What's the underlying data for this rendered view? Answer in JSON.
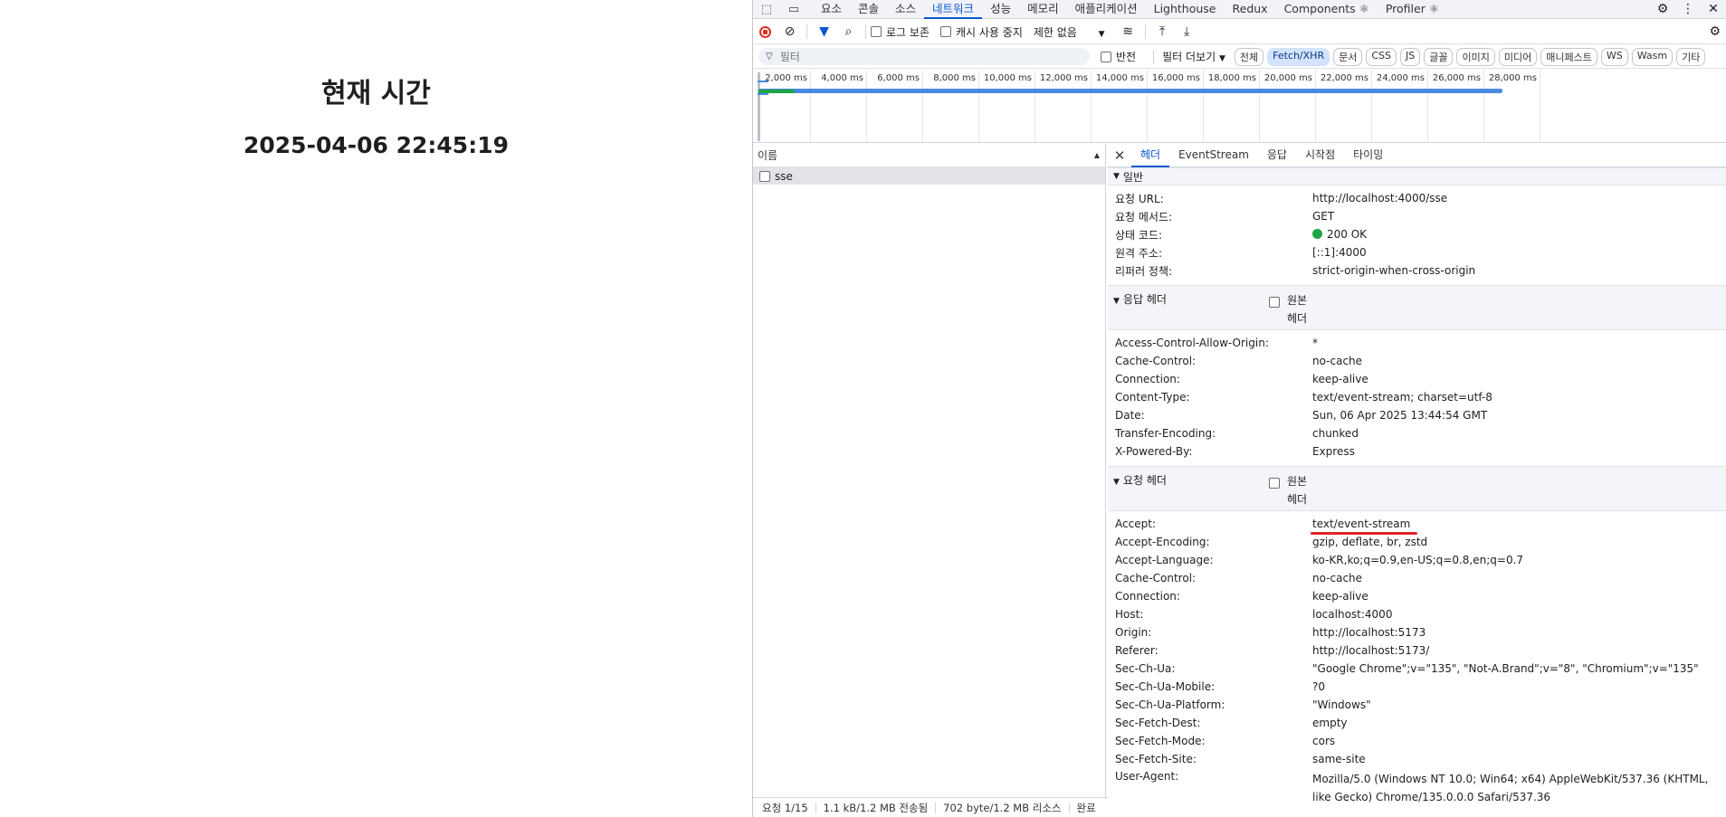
{
  "page": {
    "heading": "현재 시간",
    "current_time": "2025-04-06 22:45:19"
  },
  "devtools": {
    "tabs": [
      "요소",
      "콘솔",
      "소스",
      "네트워크",
      "성능",
      "메모리",
      "애플리케이션",
      "Lighthouse",
      "Redux",
      "Components ⚛",
      "Profiler ⚛"
    ],
    "active_tab": "네트워크",
    "toolbar": {
      "preserve_log": "로그 보존",
      "disable_cache": "캐시 사용 중지",
      "throttle": "제한 없음"
    },
    "filter": {
      "placeholder": "필터",
      "invert": "반전",
      "more_filters": "필터 더보기",
      "types": [
        "전체",
        "Fetch/XHR",
        "문서",
        "CSS",
        "JS",
        "글꼴",
        "이미지",
        "미디어",
        "매니페스트",
        "WS",
        "Wasm",
        "기타"
      ],
      "active_type": "Fetch/XHR"
    },
    "timeline_ticks": [
      "2,000 ms",
      "4,000 ms",
      "6,000 ms",
      "8,000 ms",
      "10,000 ms",
      "12,000 ms",
      "14,000 ms",
      "16,000 ms",
      "18,000 ms",
      "20,000 ms",
      "22,000 ms",
      "24,000 ms",
      "26,000 ms",
      "28,000 ms"
    ],
    "list": {
      "column_name": "이름",
      "rows": [
        "sse"
      ]
    },
    "detail_tabs": [
      "헤더",
      "EventStream",
      "응답",
      "시작점",
      "타이밍"
    ],
    "active_detail_tab": "헤더",
    "general": {
      "title": "일반",
      "rows": [
        {
          "k": "요청 URL:",
          "v": "http://localhost:4000/sse"
        },
        {
          "k": "요청 메서드:",
          "v": "GET"
        },
        {
          "k": "상태 코드:",
          "v": "200 OK"
        },
        {
          "k": "원격 주소:",
          "v": "[::1]:4000"
        },
        {
          "k": "리퍼러 정책:",
          "v": "strict-origin-when-cross-origin"
        }
      ]
    },
    "raw_label_1": "원본",
    "raw_label_2": "헤더",
    "response_headers": {
      "title": "응답 헤더",
      "rows": [
        {
          "k": "Access-Control-Allow-Origin:",
          "v": "*"
        },
        {
          "k": "Cache-Control:",
          "v": "no-cache"
        },
        {
          "k": "Connection:",
          "v": "keep-alive"
        },
        {
          "k": "Content-Type:",
          "v": "text/event-stream; charset=utf-8"
        },
        {
          "k": "Date:",
          "v": "Sun, 06 Apr 2025 13:44:54 GMT"
        },
        {
          "k": "Transfer-Encoding:",
          "v": "chunked"
        },
        {
          "k": "X-Powered-By:",
          "v": "Express"
        }
      ]
    },
    "request_headers": {
      "title": "요청 헤더",
      "rows": [
        {
          "k": "Accept:",
          "v": "text/event-stream"
        },
        {
          "k": "Accept-Encoding:",
          "v": "gzip, deflate, br, zstd"
        },
        {
          "k": "Accept-Language:",
          "v": "ko-KR,ko;q=0.9,en-US;q=0.8,en;q=0.7"
        },
        {
          "k": "Cache-Control:",
          "v": "no-cache"
        },
        {
          "k": "Connection:",
          "v": "keep-alive"
        },
        {
          "k": "Host:",
          "v": "localhost:4000"
        },
        {
          "k": "Origin:",
          "v": "http://localhost:5173"
        },
        {
          "k": "Referer:",
          "v": "http://localhost:5173/"
        },
        {
          "k": "Sec-Ch-Ua:",
          "v": "\"Google Chrome\";v=\"135\", \"Not-A.Brand\";v=\"8\", \"Chromium\";v=\"135\""
        },
        {
          "k": "Sec-Ch-Ua-Mobile:",
          "v": "?0"
        },
        {
          "k": "Sec-Ch-Ua-Platform:",
          "v": "\"Windows\""
        },
        {
          "k": "Sec-Fetch-Dest:",
          "v": "empty"
        },
        {
          "k": "Sec-Fetch-Mode:",
          "v": "cors"
        },
        {
          "k": "Sec-Fetch-Site:",
          "v": "same-site"
        },
        {
          "k": "User-Agent:",
          "v": "Mozilla/5.0 (Windows NT 10.0; Win64; x64) AppleWebKit/537.36 (KHTML, like Gecko) Chrome/135.0.0.0 Safari/537.36"
        }
      ]
    },
    "status": {
      "requests": "요청 1/15",
      "transferred": "1.1 kB/1.2 MB 전송됨",
      "resources": "702 byte/1.2 MB 리소스",
      "finish": "완료"
    },
    "colors": {
      "accent": "#0b57d0",
      "status_ok": "#1ea446",
      "record": "#d93025",
      "highlight": "#e0242b"
    }
  }
}
